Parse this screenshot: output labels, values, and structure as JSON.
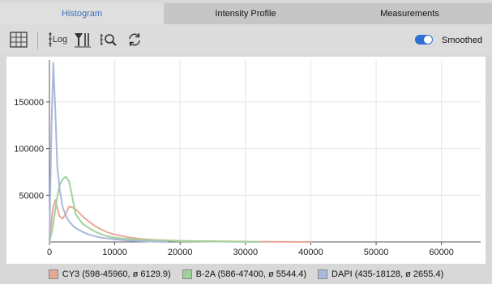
{
  "tabs": [
    {
      "label": "Histogram",
      "active": true
    },
    {
      "label": "Intensity Profile",
      "active": false
    },
    {
      "label": "Measurements",
      "active": false
    }
  ],
  "toolbar": {
    "log_label": "Log",
    "smoothed_label": "Smoothed",
    "smoothed_on": true,
    "icons": [
      "grid-icon",
      "log-scale-icon",
      "filter-icon",
      "zoom-icon",
      "reset-icon"
    ]
  },
  "chart_data": {
    "type": "line",
    "xlim": [
      0,
      66000
    ],
    "ylim": [
      0,
      195000
    ],
    "xticks": [
      0,
      10000,
      20000,
      30000,
      40000,
      50000,
      60000
    ],
    "yticks": [
      50000,
      100000,
      150000
    ],
    "grid": true,
    "legend_position": "bottom",
    "series": [
      {
        "name": "CY3 (598-45960, ø 6129.9)",
        "color": "#e6a898",
        "x": [
          0,
          500,
          900,
          1500,
          2000,
          2500,
          3000,
          3500,
          4000,
          5000,
          6000,
          7000,
          8000,
          9000,
          10000,
          11000,
          12000,
          14000,
          16000,
          20000,
          26000,
          32000,
          40000
        ],
        "y": [
          0,
          35000,
          45000,
          28000,
          25000,
          30000,
          38000,
          37000,
          35000,
          28000,
          22000,
          17000,
          13000,
          10000,
          8000,
          6500,
          5000,
          3200,
          2200,
          1200,
          600,
          300,
          0
        ]
      },
      {
        "name": "B-2A (586-47400, ø 5544.4)",
        "color": "#9fd39a",
        "x": [
          0,
          500,
          1000,
          1500,
          2000,
          2500,
          3000,
          3500,
          4000,
          5000,
          6000,
          7000,
          8000,
          9000,
          10000,
          12000,
          14000,
          17000,
          20000,
          25000,
          32000
        ],
        "y": [
          0,
          15000,
          40000,
          60000,
          67000,
          70000,
          65000,
          48000,
          30000,
          20000,
          15000,
          11000,
          8000,
          6000,
          4500,
          3000,
          2200,
          1500,
          900,
          400,
          0
        ]
      },
      {
        "name": "DAPI (435-18128, ø 2655.4)",
        "color": "#a9b8dc",
        "x": [
          0,
          300,
          600,
          900,
          1200,
          1600,
          2000,
          2500,
          3000,
          3500,
          4000,
          5000,
          6000,
          7000,
          8000,
          10000,
          12000,
          14000,
          16000,
          18000
        ],
        "y": [
          0,
          120000,
          192000,
          140000,
          80000,
          55000,
          38000,
          28000,
          22000,
          18000,
          15000,
          11000,
          8000,
          6000,
          4500,
          2800,
          1600,
          900,
          300,
          0
        ]
      }
    ]
  }
}
